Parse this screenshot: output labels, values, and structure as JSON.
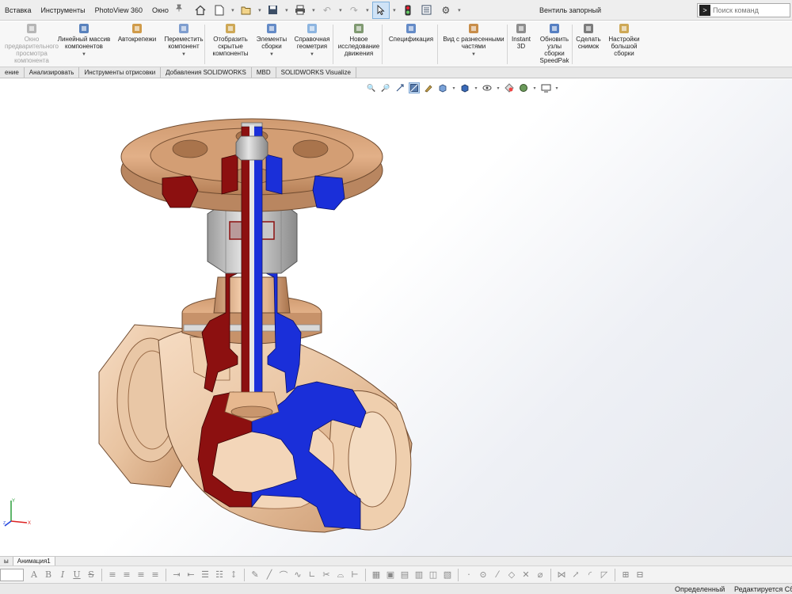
{
  "menu": {
    "items": [
      "Вставка",
      "Инструменты",
      "PhotoView 360",
      "Окно"
    ],
    "pin": "📌"
  },
  "document_title": "Вентиль запорный",
  "search": {
    "placeholder": "Поиск команд"
  },
  "ribbon": {
    "buttons": [
      {
        "label": "Окно\nпредварительного\nпросмотра\nкомпонента",
        "disabled": true,
        "icon": "preview-window-icon"
      },
      {
        "label": "Линейный массив\nкомпонентов",
        "dropdown": true,
        "icon": "linear-pattern-icon"
      },
      {
        "label": "Автокрепежи",
        "icon": "smart-fasteners-icon"
      },
      {
        "label": "Переместить\nкомпонент",
        "dropdown": true,
        "icon": "move-component-icon"
      },
      {
        "label": "Отобразить\nскрытые\nкомпоненты",
        "icon": "show-hidden-icon"
      },
      {
        "label": "Элементы\nсборки",
        "dropdown": true,
        "icon": "assembly-features-icon"
      },
      {
        "label": "Справочная\nгеометрия",
        "dropdown": true,
        "icon": "reference-geometry-icon"
      },
      {
        "label": "Новое\nисследование\nдвижения",
        "icon": "motion-study-icon"
      },
      {
        "label": "Спецификация",
        "icon": "bom-icon"
      },
      {
        "label": "Вид с разнесенными\nчастями",
        "dropdown": true,
        "icon": "exploded-view-icon"
      },
      {
        "label": "Instant\n3D",
        "icon": "instant3d-icon"
      },
      {
        "label": "Обновить\nузлы\nсборки\nSpeedPak",
        "icon": "speedpak-icon"
      },
      {
        "label": "Сделать\nснимок",
        "icon": "snapshot-icon"
      },
      {
        "label": "Настройки\nбольшой\nсборки",
        "icon": "large-assembly-icon"
      }
    ]
  },
  "tabs": [
    "ение",
    "Анализировать",
    "Инструменты отрисовки",
    "Добавления SOLIDWORKS",
    "MBD",
    "SOLIDWORKS Visualize"
  ],
  "bottom_tabs": [
    "ы",
    "Анимация1"
  ],
  "triad": {
    "x": "X",
    "y": "Y",
    "z": "Z"
  },
  "status": {
    "state": "Определенный",
    "editing": "Редактируется Сб"
  },
  "colors": {
    "brass": "#d9a57c",
    "brass_dark": "#b07a52",
    "section_red": "#8c1010",
    "section_blue": "#1a2fd9",
    "steel": "#c8c8c8",
    "selected": "#cfe3f7"
  }
}
